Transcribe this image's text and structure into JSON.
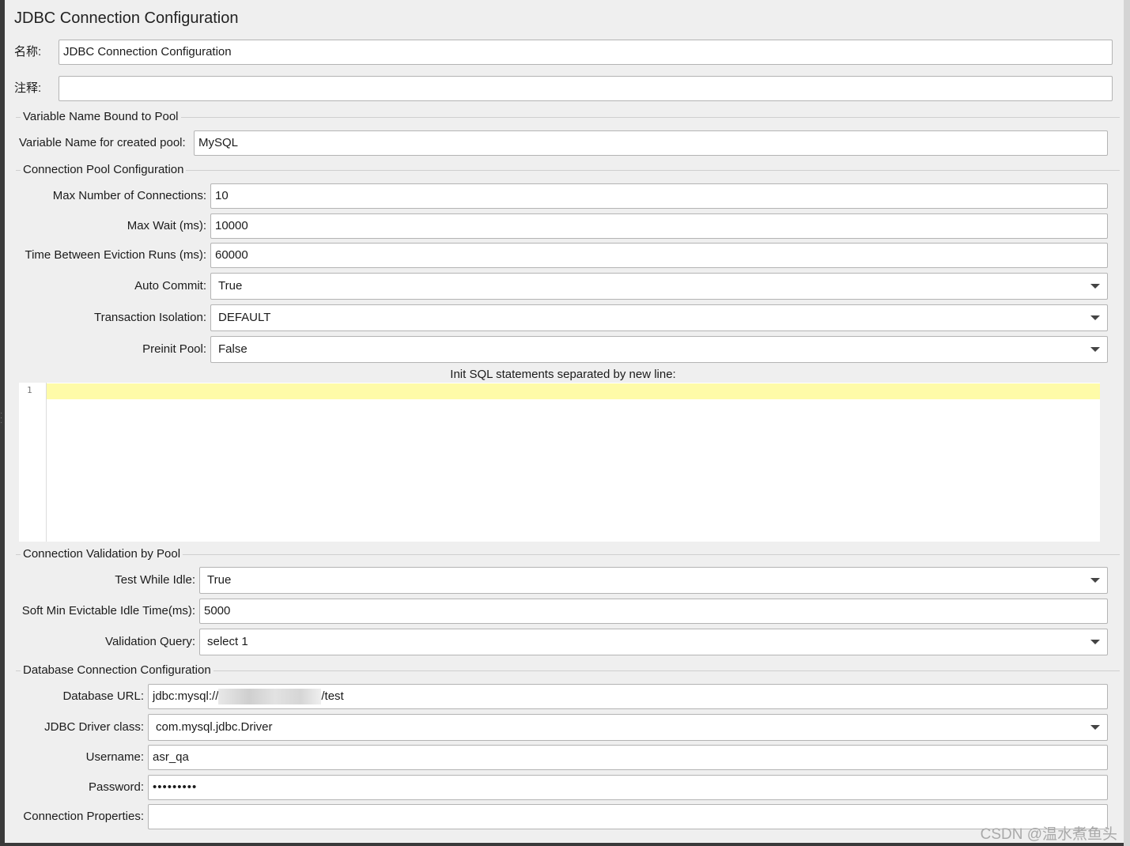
{
  "title": "JDBC Connection Configuration",
  "name_field": {
    "label": "名称:",
    "value": "JDBC Connection Configuration"
  },
  "comment_field": {
    "label": "注释:",
    "value": ""
  },
  "pool_variable": {
    "section": "Variable Name Bound to Pool",
    "label": "Variable Name for created pool:",
    "value": "MySQL"
  },
  "pool_config": {
    "section": "Connection Pool Configuration",
    "max_connections": {
      "label": "Max Number of Connections:",
      "value": "10"
    },
    "max_wait": {
      "label": "Max Wait (ms):",
      "value": "10000"
    },
    "eviction": {
      "label": "Time Between Eviction Runs (ms):",
      "value": "60000"
    },
    "auto_commit": {
      "label": "Auto Commit:",
      "value": "True"
    },
    "isolation": {
      "label": "Transaction Isolation:",
      "value": "DEFAULT"
    },
    "preinit": {
      "label": "Preinit Pool:",
      "value": "False"
    },
    "init_sql": {
      "label": "Init SQL statements separated by new line:",
      "line_number": "1"
    }
  },
  "validation": {
    "section": "Connection Validation by Pool",
    "test_idle": {
      "label": "Test While Idle:",
      "value": "True"
    },
    "soft_min": {
      "label": "Soft Min Evictable Idle Time(ms):",
      "value": "5000"
    },
    "query": {
      "label": "Validation Query:",
      "value": "select 1"
    }
  },
  "database": {
    "section": "Database Connection Configuration",
    "url": {
      "label": "Database URL:",
      "prefix": "jdbc:mysql://",
      "suffix": "/test"
    },
    "driver": {
      "label": "JDBC Driver class:",
      "value": "com.mysql.jdbc.Driver"
    },
    "username": {
      "label": "Username:",
      "value": "asr_qa"
    },
    "password": {
      "label": "Password:",
      "value": "•••••••••"
    },
    "properties": {
      "label": "Connection Properties:",
      "value": ""
    }
  },
  "watermark": "CSDN @温水煮鱼头"
}
